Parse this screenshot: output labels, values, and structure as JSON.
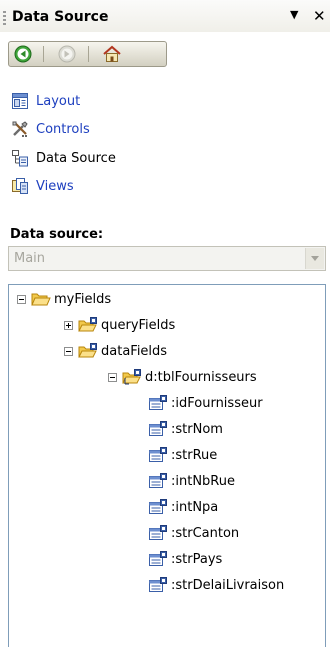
{
  "panel": {
    "title": "Data Source"
  },
  "tasks": [
    {
      "label": "Layout",
      "icon": "layout-icon"
    },
    {
      "label": "Controls",
      "icon": "controls-icon"
    },
    {
      "label": "Data Source",
      "icon": "data-source-icon"
    },
    {
      "label": "Views",
      "icon": "views-icon"
    }
  ],
  "data_source": {
    "label": "Data source:",
    "selected": "Main"
  },
  "tree": {
    "root": "myFields",
    "query_group": "queryFields",
    "data_group": "dataFields",
    "table": "d:tblFournisseurs",
    "fields": [
      ":idFournisseur",
      ":strNom",
      ":strRue",
      ":intNbRue",
      ":intNpa",
      ":strCanton",
      ":strPays",
      ":strDelaiLivraison"
    ]
  }
}
